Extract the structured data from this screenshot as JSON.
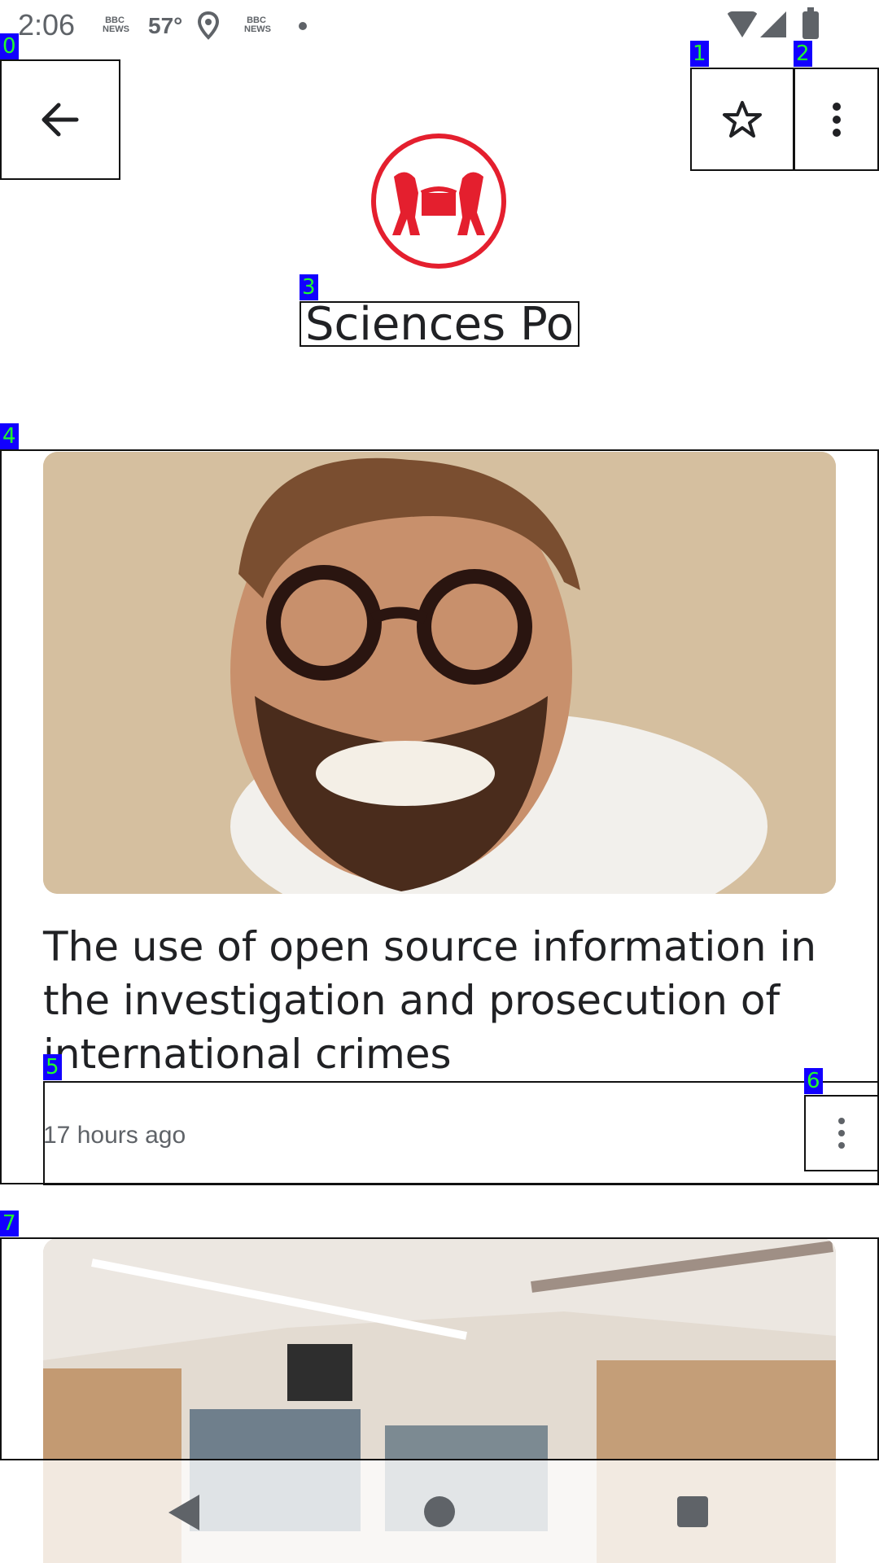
{
  "status_bar": {
    "time": "2:06",
    "temperature": "57°",
    "news_icon_label": "BBC NEWS",
    "icons": [
      "bbc-news-icon",
      "location-icon",
      "bbc-news-icon",
      "dot-icon",
      "wifi-icon",
      "signal-icon",
      "battery-icon"
    ]
  },
  "header": {
    "title": "Sciences Po",
    "back_icon": "arrow-left-icon",
    "star_icon": "star-outline-icon",
    "more_icon": "more-vertical-icon",
    "logo_color": "#e41f2e"
  },
  "articles": [
    {
      "headline": "The use of open source information in the investigation and prosecution of international crimes",
      "timestamp": "17 hours ago",
      "more_icon": "more-vertical-icon"
    },
    {
      "headline": "",
      "timestamp": ""
    }
  ],
  "labels": [
    "0",
    "1",
    "2",
    "3",
    "4",
    "5",
    "6",
    "7"
  ],
  "nav_bar": {
    "icons": [
      "back-triangle-icon",
      "home-circle-icon",
      "recents-square-icon"
    ]
  }
}
